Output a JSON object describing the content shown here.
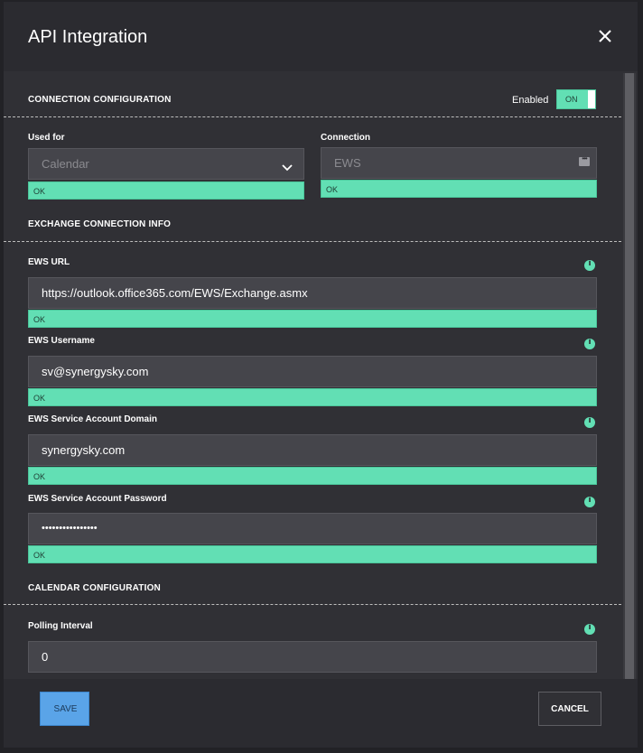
{
  "modal": {
    "title": "API Integration",
    "close_icon": "close-icon"
  },
  "connection_config": {
    "section_title": "CONNECTION CONFIGURATION",
    "enabled_label": "Enabled",
    "toggle_label": "ON",
    "used_for": {
      "label": "Used for",
      "value": "Calendar",
      "status": "OK"
    },
    "connection": {
      "label": "Connection",
      "value": "EWS",
      "status": "OK"
    }
  },
  "exchange_info": {
    "section_title": "EXCHANGE CONNECTION INFO",
    "ews_url": {
      "label": "EWS URL",
      "value": "https://outlook.office365.com/EWS/Exchange.asmx",
      "status": "OK"
    },
    "ews_username": {
      "label": "EWS Username",
      "value": "sv@synergysky.com",
      "status": "OK"
    },
    "ews_domain": {
      "label": "EWS Service Account Domain",
      "value": "synergysky.com",
      "status": "OK"
    },
    "ews_password": {
      "label": "EWS Service Account Password",
      "value": "••••••••••••••••",
      "status": "OK"
    }
  },
  "calendar_config": {
    "section_title": "CALENDAR CONFIGURATION",
    "polling_interval": {
      "label": "Polling Interval",
      "value": "0"
    }
  },
  "footer": {
    "save_label": "SAVE",
    "cancel_label": "CANCEL"
  },
  "colors": {
    "accent_green": "#62dfb4",
    "save_blue": "#5aa4e8",
    "background": "#303035"
  },
  "icons": [
    "close-icon",
    "chevron-down-icon",
    "more-dots-icon",
    "info-icon"
  ]
}
